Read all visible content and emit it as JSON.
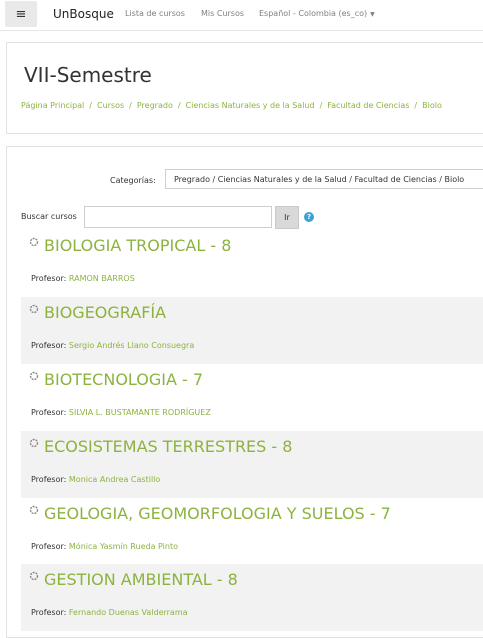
{
  "navbar": {
    "menu_icon": "hamburger-icon",
    "brand": "UnBosque",
    "links": [
      "Lista de cursos",
      "Mis Cursos"
    ],
    "language": "Español - Colombia (es_co)"
  },
  "header": {
    "title": "VII-Semestre",
    "breadcrumb": [
      "Página Principal",
      "Cursos",
      "Pregrado",
      "Ciencias Naturales y de la Salud",
      "Facultad de Ciencias",
      "Biolo"
    ]
  },
  "filters": {
    "category_label": "Categorías:",
    "category_value": "Pregrado / Ciencias Naturales y de la Salud / Facultad de Ciencias / Biolo",
    "search_label": "Buscar cursos",
    "search_value": "",
    "search_button": "Ir",
    "help_icon": "question-circle-icon"
  },
  "courses": [
    {
      "name": "BIOLOGIA TROPICAL - 8",
      "teacher_label": "Profesor:",
      "teacher": "RAMON BARROS"
    },
    {
      "name": "BIOGEOGRAFÍA",
      "teacher_label": "Profesor:",
      "teacher": "Sergio Andrés Llano Consuegra"
    },
    {
      "name": "BIOTECNOLOGIA - 7",
      "teacher_label": "Profesor:",
      "teacher": "SILVIA L. BUSTAMANTE RODRÍGUEZ"
    },
    {
      "name": "ECOSISTEMAS TERRESTRES - 8",
      "teacher_label": "Profesor:",
      "teacher": "Monica Andrea Castillo"
    },
    {
      "name": "GEOLOGIA, GEOMORFOLOGIA Y SUELOS - 7",
      "teacher_label": "Profesor:",
      "teacher": "Mónica Yasmín Rueda Pinto"
    },
    {
      "name": "GESTION AMBIENTAL - 8",
      "teacher_label": "Profesor:",
      "teacher": "Fernando Duenas Valderrama"
    }
  ],
  "colors": {
    "accent": "#8cb33e",
    "row_alt": "#f2f2f2",
    "help": "#3aa0d5"
  }
}
